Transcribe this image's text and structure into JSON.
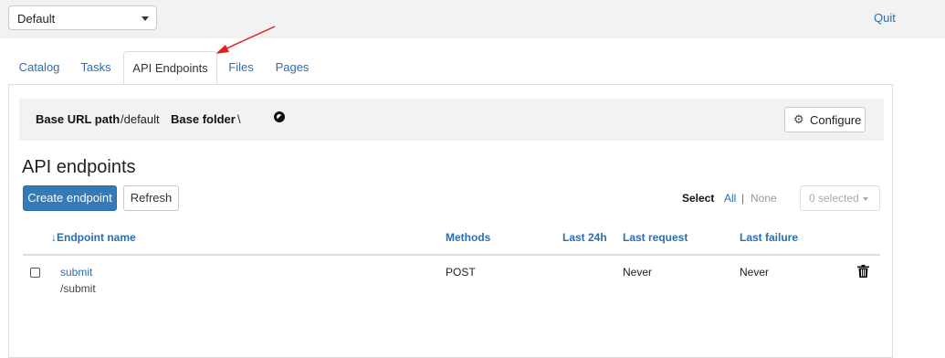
{
  "topbar": {
    "profile_value": "Default",
    "quit_label": "Quit"
  },
  "tabs": [
    {
      "label": "Catalog",
      "active": false
    },
    {
      "label": "Tasks",
      "active": false
    },
    {
      "label": "API Endpoints",
      "active": true
    },
    {
      "label": "Files",
      "active": false
    },
    {
      "label": "Pages",
      "active": false
    }
  ],
  "info": {
    "base_url_label": "Base URL path",
    "base_url_value": "/default",
    "base_folder_label": "Base folder",
    "base_folder_value": "\\",
    "configure_label": "Configure"
  },
  "main": {
    "title": "API endpoints",
    "create_label": "Create endpoint",
    "refresh_label": "Refresh",
    "select_label": "Select",
    "select_all": "All",
    "select_sep": "|",
    "select_none": "None",
    "selected_count": "0 selected"
  },
  "table": {
    "sort_arrow": "↓",
    "columns": {
      "name": "Endpoint name",
      "methods": "Methods",
      "last24h": "Last 24h",
      "last_request": "Last request",
      "last_failure": "Last failure"
    },
    "rows": [
      {
        "name": "submit",
        "path": "/submit",
        "methods": "POST",
        "last24h": "",
        "last_request": "Never",
        "last_failure": "Never"
      }
    ]
  },
  "colors": {
    "link": "#2a6db0",
    "primary": "#337ab7",
    "annotation_arrow": "#e02020"
  },
  "icons": [
    "caret-down-icon",
    "circle-half-icon",
    "gear-icon",
    "sort-down-icon",
    "trash-icon",
    "annotation-arrow"
  ]
}
